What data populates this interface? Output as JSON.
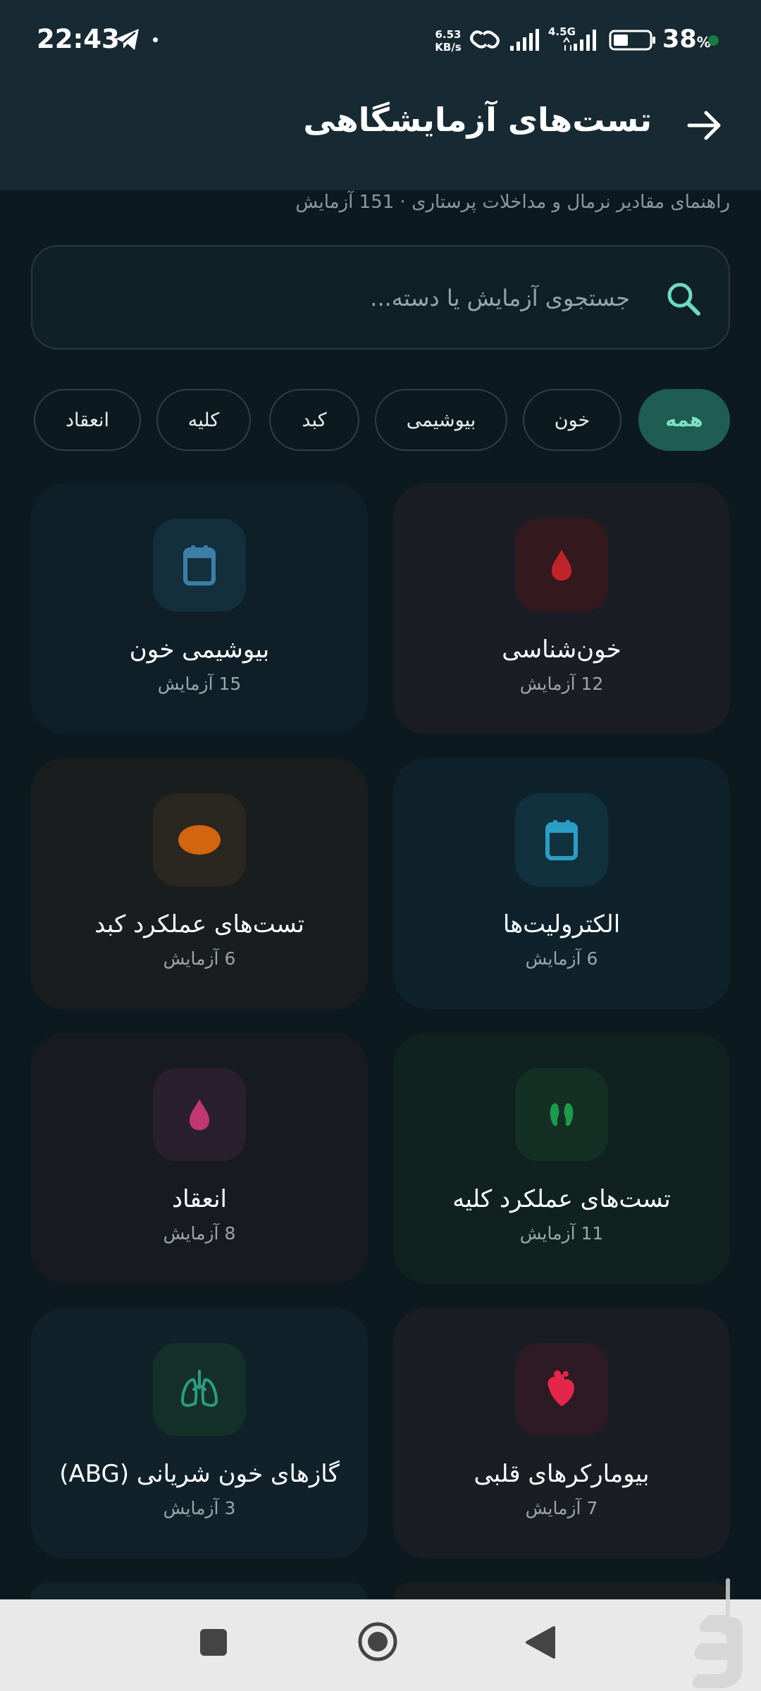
{
  "status_bar": {
    "time": "22:43",
    "net_speed_value": "6.53",
    "net_speed_unit": "KB/s",
    "network_type": "4.5G",
    "battery_percent": "38",
    "battery_symbol": "%",
    "icons": [
      "telegram-icon",
      "dot-icon",
      "link-icon",
      "signal-icon",
      "signal-icon",
      "battery-icon"
    ]
  },
  "header": {
    "title": "تست‌های آزمایشگاهی",
    "subtitle": "راهنمای مقادیر نرمال و مداخلات پرستاری · 151 آزمایش",
    "back_icon": "arrow-right-icon"
  },
  "search": {
    "placeholder": "جستجوی آزمایش یا دسته...",
    "value": "",
    "icon": "search-icon"
  },
  "filters": [
    {
      "label": "همه",
      "active": true
    },
    {
      "label": "خون",
      "active": false
    },
    {
      "label": "بیوشیمی",
      "active": false
    },
    {
      "label": "کبد",
      "active": false
    },
    {
      "label": "کلیه",
      "active": false
    },
    {
      "label": "انعقاد",
      "active": false
    }
  ],
  "categories": [
    {
      "name": "خون‌شناسی",
      "count": "12 آزمایش",
      "icon": "blood-drop-icon",
      "color": "#c0242b"
    },
    {
      "name": "بیوشیمی خون",
      "count": "15 آزمایش",
      "icon": "calendar-icon",
      "color": "#3c7fa6"
    },
    {
      "name": "الکترولیت‌ها",
      "count": "6 آزمایش",
      "icon": "calendar-icon",
      "color": "#2b9ec6"
    },
    {
      "name": "تست‌های عملکرد کبد",
      "count": "6 آزمایش",
      "icon": "liver-icon",
      "color": "#d2650f"
    },
    {
      "name": "تست‌های عملکرد کلیه",
      "count": "11 آزمایش",
      "icon": "kidneys-icon",
      "color": "#1f9a4c"
    },
    {
      "name": "انعقاد",
      "count": "8 آزمایش",
      "icon": "drop-icon",
      "color": "#c0386f"
    },
    {
      "name": "بیومارکرهای قلبی",
      "count": "7 آزمایش",
      "icon": "heart-icon",
      "color": "#e3264a"
    },
    {
      "name": "گازهای خون شریانی (ABG)",
      "count": "3 آزمایش",
      "icon": "lungs-icon",
      "color": "#2d9c82"
    }
  ],
  "nav_bar": {
    "buttons": [
      "recents-square-icon",
      "home-circle-icon",
      "back-triangle-icon"
    ],
    "background": "#e9e9e9"
  }
}
